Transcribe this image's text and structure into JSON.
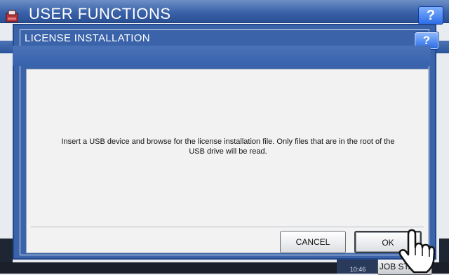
{
  "background": {
    "title": "USER FUNCTIONS",
    "help_label": "?",
    "clock": "10:46",
    "job_status_label": "JOB STATUS"
  },
  "dialog": {
    "title": "LICENSE INSTALLATION",
    "help_label": "?",
    "message": "Insert a USB device and browse for the license installation file. Only files that are in the root of the USB drive will be read.",
    "buttons": {
      "cancel": "CANCEL",
      "ok": "OK"
    }
  },
  "icons": {
    "logo": "printer-logo-icon",
    "cursor": "hand-pointer-icon"
  },
  "colors": {
    "header_blue": "#3a63aa",
    "help_blue": "#2c6be3",
    "content_bg": "#f2f2f2"
  }
}
